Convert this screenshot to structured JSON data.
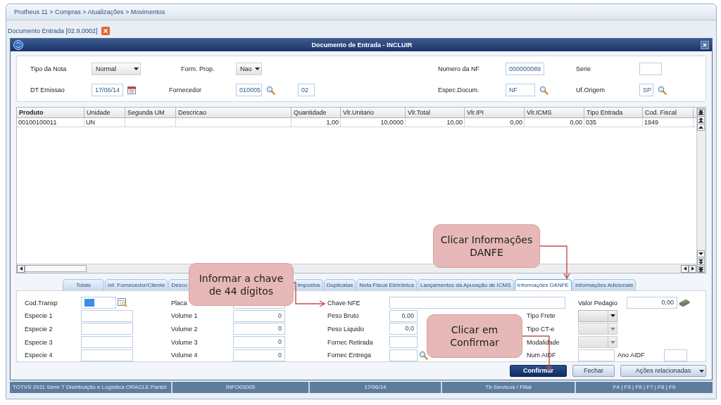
{
  "breadcrumb": "Protheus 11 > Compras  > Atualizações > Movimentos",
  "doc_tab": {
    "label": "Documento Entrada [02.9.0002]"
  },
  "dialog": {
    "title": "Documento de Entrada - INCLUIR"
  },
  "header": {
    "rows": [
      [
        {
          "label": "Tipo da Nota",
          "field": {
            "kind": "select",
            "value": "Normal"
          }
        },
        {
          "label": "Form. Prop.",
          "field": {
            "kind": "select",
            "value": "Nao"
          }
        },
        {
          "label": "Numero da NF",
          "field": {
            "kind": "text",
            "value": "000000089"
          }
        },
        {
          "label": "Serie",
          "field": {
            "kind": "text"
          }
        }
      ],
      [
        {
          "label": "DT Emissao",
          "field": {
            "kind": "date",
            "value": "17/06/14"
          }
        },
        {
          "label": "Fornecedor",
          "field": {
            "kind": "lookup",
            "value": "010005",
            "extra_value": "02"
          }
        },
        {
          "label": "Espec.Docum.",
          "field": {
            "kind": "lookup",
            "value": "NF"
          }
        },
        {
          "label": "Uf.Origem",
          "field": {
            "kind": "lookup",
            "value": "SP"
          }
        }
      ]
    ]
  },
  "grid": {
    "columns": [
      "Produto",
      "Unidade",
      "Segunda UM",
      "Descricao",
      "Quantidade",
      "Vlr.Unitario",
      "Vlr.Total",
      "Vlr.IPI",
      "Vlr.ICMS",
      "Tipo Entrada",
      "Cod. Fiscal"
    ],
    "rows": [
      [
        "00100100011",
        "UN",
        null,
        null,
        "1,00",
        "10,0000",
        "10,00",
        "0,00",
        "0,00",
        "035",
        "1949"
      ]
    ]
  },
  "bottom_tabs": [
    {
      "label": "Totais",
      "selected": false
    },
    {
      "label": "Inf. Fornecedor/Cliente",
      "selected": false
    },
    {
      "label": "Desco",
      "selected": false
    },
    {
      "label": "Impostos",
      "selected": false
    },
    {
      "label": "Duplicatas",
      "selected": false
    },
    {
      "label": "Nota Fiscal Eletrônica",
      "selected": false
    },
    {
      "label": "Lançamentos da Apuração de ICMS",
      "selected": false
    },
    {
      "label": "Informações DANFE",
      "selected": true
    },
    {
      "label": "Informações Adicionais",
      "selected": false
    }
  ],
  "danfe": {
    "rows": [
      [
        {
          "label": "Cod.Transp",
          "field": {
            "kind": "code",
            "focused": true
          }
        },
        {
          "label": "Placa",
          "field": {
            "kind": "text"
          }
        },
        {
          "label": "Chave NFE",
          "field": {
            "kind": "text"
          }
        },
        null,
        {
          "label": "Valor Pedagio",
          "field": {
            "kind": "money",
            "value": "0,00"
          }
        }
      ],
      [
        {
          "label": "Especie 1",
          "field": {
            "kind": "text"
          }
        },
        {
          "label": "Volume 1",
          "field": {
            "kind": "text",
            "value": "0"
          }
        },
        {
          "label": "Peso Bruto",
          "field": {
            "kind": "text",
            "value": "0,00"
          }
        },
        {
          "label": "Tipo Frete",
          "field": {
            "kind": "select",
            "disabled": false
          }
        }
      ],
      [
        {
          "label": "Especie 2",
          "field": {
            "kind": "text"
          }
        },
        {
          "label": "Volume 2",
          "field": {
            "kind": "text",
            "value": "0"
          }
        },
        {
          "label": "Peso Liquido",
          "field": {
            "kind": "text",
            "value": "0,0"
          }
        },
        {
          "label": "Tipo CT-e",
          "field": {
            "kind": "select",
            "disabled": true
          }
        }
      ],
      [
        {
          "label": "Especie 3",
          "field": {
            "kind": "text"
          }
        },
        {
          "label": "Volume 3",
          "field": {
            "kind": "text",
            "value": "0"
          }
        },
        {
          "label": "Fornec Retirada",
          "field": {
            "kind": "text"
          }
        },
        {
          "label": "Modalidade",
          "field": {
            "kind": "select",
            "disabled": true
          }
        }
      ],
      [
        {
          "label": "Especie 4",
          "field": {
            "kind": "text"
          }
        },
        {
          "label": "Volume 4",
          "field": {
            "kind": "text",
            "value": "0"
          }
        },
        {
          "label": "Fornec Entrega",
          "field": {
            "kind": "lookup"
          }
        },
        {
          "label": "Num AIDF",
          "field": {
            "kind": "text"
          }
        },
        {
          "label": "Ano AIDF",
          "field": {
            "kind": "text"
          }
        }
      ]
    ]
  },
  "buttons": [
    {
      "label": "Confirmar",
      "kind": "primary"
    },
    {
      "label": "Fechar",
      "kind": "normal"
    },
    {
      "label": "Ações relacionadas",
      "kind": "menu"
    }
  ],
  "status_bar": [
    "TOTVS 2011 Série T Distribuição e Logística ORACLE Partsil",
    "INFO03005",
    "17/06/14",
    "Tb Servicos / Filial",
    "F4 | F5 | F6 | F7 | F8 | F9"
  ],
  "callouts": [
    {
      "text": "Informar a chave\nde 44 dígitos"
    },
    {
      "text": "Clicar  Informações\nDANFE"
    },
    {
      "text": "Clicar  em\nConfirmar"
    }
  ]
}
